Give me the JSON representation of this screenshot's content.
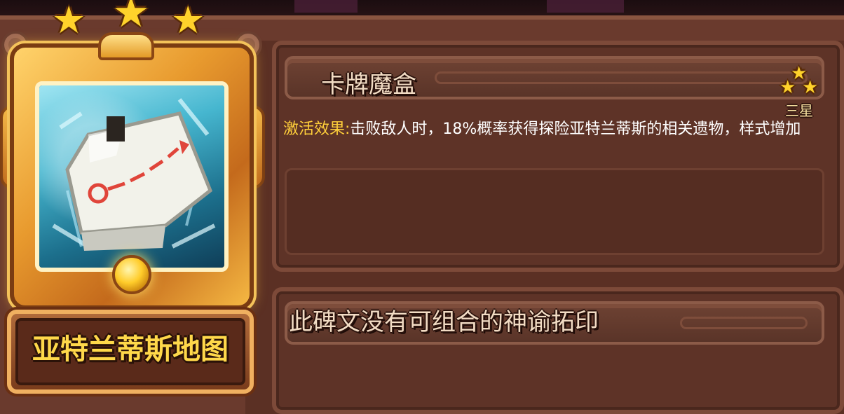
{
  "card": {
    "name": "亚特兰蒂斯地图",
    "star_count": 3,
    "icon": "treasure-map-icon",
    "frame_color": "#f0a43a"
  },
  "effect_panel": {
    "title": "卡牌魔盒",
    "rank_label": "三星",
    "effect_label": "激活效果:",
    "effect_text": "击败敌人时，18%概率获得探险亚特兰蒂斯的相关遗物，样式增加",
    "label_color": "#ffcf3a"
  },
  "combo_panel": {
    "title": "此碑文没有可组合的神谕拓印"
  }
}
